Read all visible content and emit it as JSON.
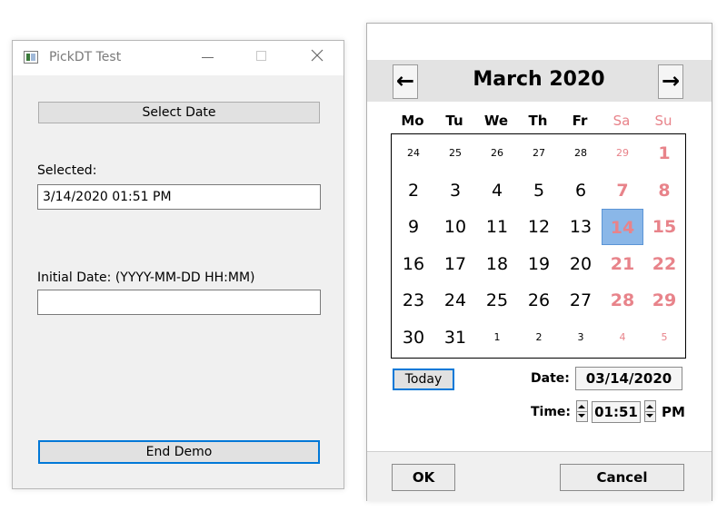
{
  "left_window": {
    "title": "PickDT Test",
    "select_date_label": "Select Date",
    "selected_label": "Selected:",
    "selected_value": "3/14/2020 01:51 PM",
    "initial_date_label": "Initial Date: (YYYY-MM-DD HH:MM)",
    "initial_date_value": "",
    "end_demo_label": "End Demo"
  },
  "calendar": {
    "prev_icon": "←",
    "next_icon": "→",
    "month_title": "March 2020",
    "weekdays": [
      "Mo",
      "Tu",
      "We",
      "Th",
      "Fr",
      "Sa",
      "Su"
    ],
    "weeks": [
      [
        "24",
        "25",
        "26",
        "27",
        "28",
        "29",
        "1"
      ],
      [
        "2",
        "3",
        "4",
        "5",
        "6",
        "7",
        "8"
      ],
      [
        "9",
        "10",
        "11",
        "12",
        "13",
        "14",
        "15"
      ],
      [
        "16",
        "17",
        "18",
        "19",
        "20",
        "21",
        "22"
      ],
      [
        "23",
        "24",
        "25",
        "26",
        "27",
        "28",
        "29"
      ],
      [
        "30",
        "31",
        "1",
        "2",
        "3",
        "4",
        "5"
      ]
    ],
    "selected_day": "14",
    "today_label": "Today",
    "date_label": "Date:",
    "date_value": "03/14/2020",
    "time_label": "Time:",
    "time_value": "01:51",
    "ampm": "PM",
    "ok_label": "OK",
    "cancel_label": "Cancel",
    "colors": {
      "weekend": "#e8838a",
      "selected_bg": "#8ab7e8",
      "focus_border": "#0078d7"
    }
  }
}
